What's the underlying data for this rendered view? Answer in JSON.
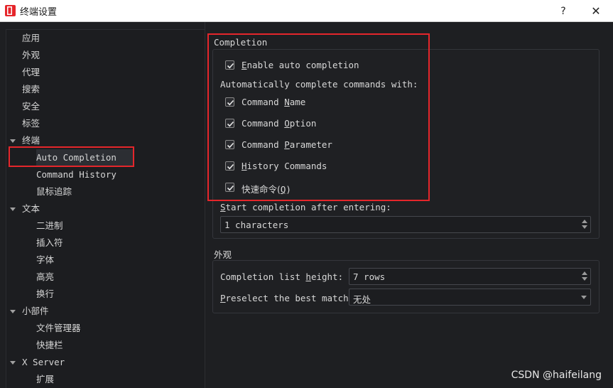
{
  "window": {
    "title": "终端设置",
    "help_label": "?",
    "close_label": "✕",
    "icon": "app-logo-icon",
    "accent": "#e5262b"
  },
  "sidebar": {
    "items": [
      {
        "label": "应用",
        "level": 1,
        "expandable": false
      },
      {
        "label": "外观",
        "level": 1,
        "expandable": false
      },
      {
        "label": "代理",
        "level": 1,
        "expandable": false
      },
      {
        "label": "搜索",
        "level": 1,
        "expandable": false
      },
      {
        "label": "安全",
        "level": 1,
        "expandable": false
      },
      {
        "label": "标签",
        "level": 1,
        "expandable": false
      },
      {
        "label": "终端",
        "level": 1,
        "expandable": true
      },
      {
        "label": "Auto Completion",
        "level": 2,
        "selected": true
      },
      {
        "label": "Command History",
        "level": 2
      },
      {
        "label": "鼠标追踪",
        "level": 2
      },
      {
        "label": "文本",
        "level": 1,
        "expandable": true
      },
      {
        "label": "二进制",
        "level": 2
      },
      {
        "label": "插入符",
        "level": 2
      },
      {
        "label": "字体",
        "level": 2
      },
      {
        "label": "高亮",
        "level": 2
      },
      {
        "label": "换行",
        "level": 2
      },
      {
        "label": "小部件",
        "level": 1,
        "expandable": true
      },
      {
        "label": "文件管理器",
        "level": 2
      },
      {
        "label": "快捷栏",
        "level": 2
      },
      {
        "label": "X Server",
        "level": 1,
        "expandable": true
      },
      {
        "label": "扩展",
        "level": 2
      }
    ]
  },
  "completion": {
    "group_title": "Completion",
    "enable": {
      "checked": true,
      "mnemonic": "E",
      "rest": "nable auto completion"
    },
    "auto_label": "Automatically complete commands with:",
    "command_name": {
      "checked": true,
      "pre": "Command ",
      "mnemonic": "N",
      "rest": "ame"
    },
    "command_option": {
      "checked": true,
      "pre": "Command ",
      "mnemonic": "O",
      "rest": "ption"
    },
    "command_parameter": {
      "checked": true,
      "pre": "Command ",
      "mnemonic": "P",
      "rest": "arameter"
    },
    "history_commands": {
      "checked": true,
      "pre": "",
      "mnemonic": "H",
      "rest": "istory Commands"
    },
    "quick_commands": {
      "checked": true,
      "pre": "快速命令(",
      "mnemonic": "Q",
      "rest": ")"
    },
    "start_label_mnemonic": "S",
    "start_label_rest": "tart completion after entering:",
    "start_value": "1 characters"
  },
  "appearance": {
    "group_title": "外观",
    "list_height_pre": "Completion list ",
    "list_height_mnemonic": "h",
    "list_height_rest": "eight:",
    "list_height_value": "7 rows",
    "preselect_mnemonic": "P",
    "preselect_rest": "reselect the best match:",
    "preselect_value": "无处"
  },
  "watermark": "CSDN @haifeilang"
}
